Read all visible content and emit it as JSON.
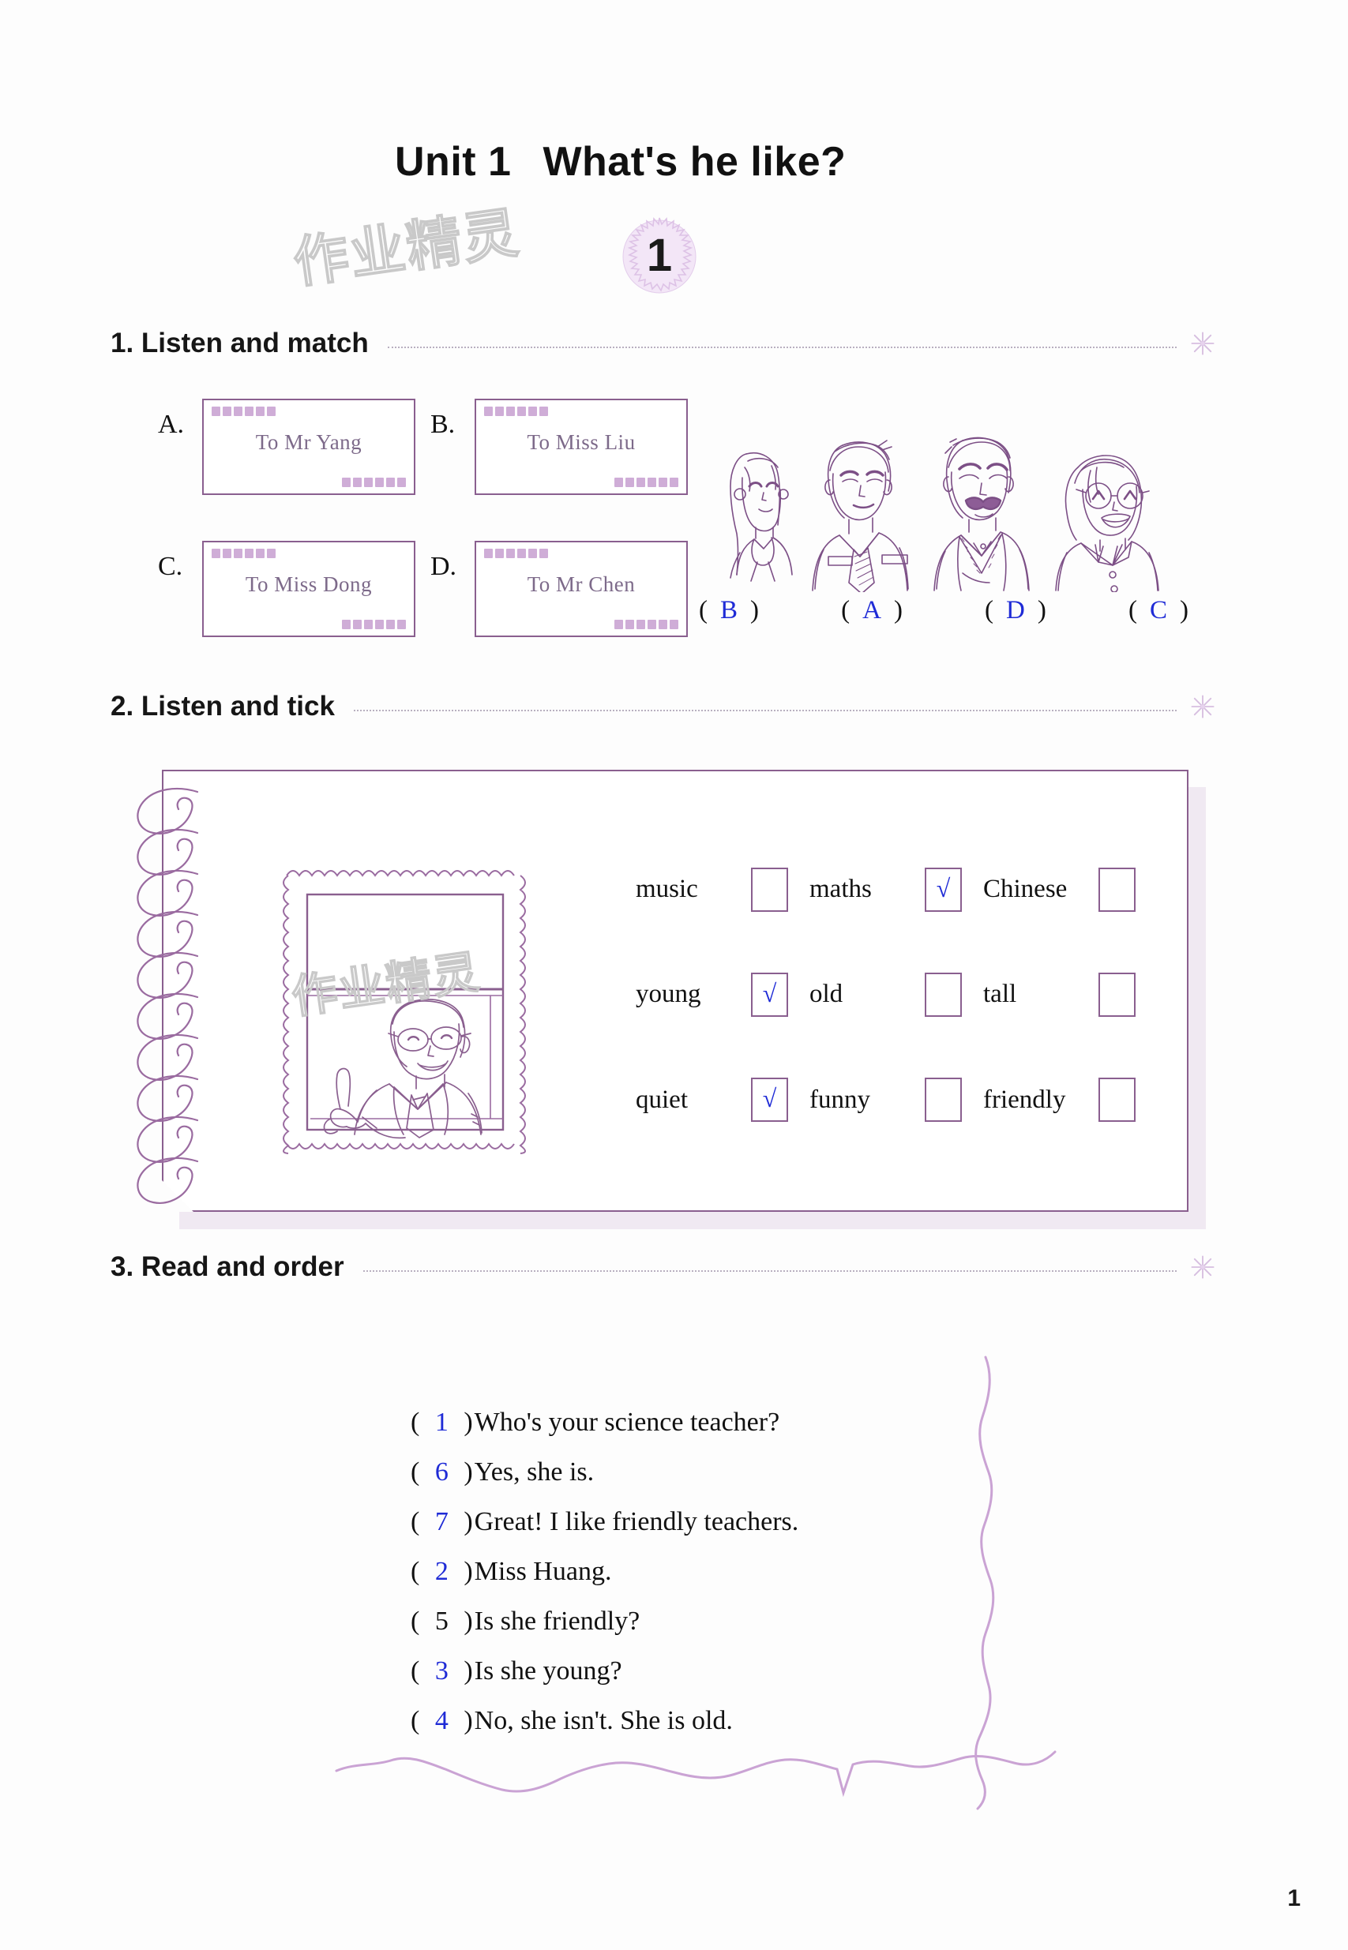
{
  "page": {
    "title_unit": "Unit 1",
    "title_question": "What's he like?",
    "unit_badge_number": "1",
    "watermark_text": "作业精灵",
    "page_number": "1",
    "accent_purple": "#8a5f8f",
    "accent_blue": "#1f2bd6",
    "stamp_purple": "#c79fd0"
  },
  "section1": {
    "number": "1.",
    "label": "1.  Listen and match",
    "envelopes": [
      {
        "letter": "A.",
        "text": "To Mr Yang"
      },
      {
        "letter": "B.",
        "text": "To Miss Liu"
      },
      {
        "letter": "C.",
        "text": "To Miss Dong"
      },
      {
        "letter": "D.",
        "text": "To Mr Chen"
      }
    ],
    "answers": [
      {
        "open": "(",
        "value": "B",
        "close": ")"
      },
      {
        "open": "(",
        "value": "A",
        "close": ")"
      },
      {
        "open": "(",
        "value": "D",
        "close": ")"
      },
      {
        "open": "(",
        "value": "C",
        "close": ")"
      }
    ],
    "people_icon": "four-teachers-illustration"
  },
  "section2": {
    "label": "2.  Listen and tick",
    "photo_icon": "framed-teacher-photo",
    "options": [
      {
        "label": "music",
        "checked": false,
        "mark": ""
      },
      {
        "label": "maths",
        "checked": true,
        "mark": "√"
      },
      {
        "label": "Chinese",
        "checked": false,
        "mark": ""
      },
      {
        "label": "young",
        "checked": true,
        "mark": "√"
      },
      {
        "label": "old",
        "checked": false,
        "mark": ""
      },
      {
        "label": "tall",
        "checked": false,
        "mark": ""
      },
      {
        "label": "quiet",
        "checked": true,
        "mark": "√"
      },
      {
        "label": "funny",
        "checked": false,
        "mark": ""
      },
      {
        "label": "friendly",
        "checked": false,
        "mark": ""
      }
    ]
  },
  "section3": {
    "label": "3.  Read and order",
    "lines": [
      {
        "open": "(",
        "num": "1",
        "close": ")",
        "sentence": "Who's your science teacher?",
        "num_color": "blue"
      },
      {
        "open": "(",
        "num": "6",
        "close": ")",
        "sentence": "Yes, she is.",
        "num_color": "blue"
      },
      {
        "open": "(",
        "num": "7",
        "close": ")",
        "sentence": "Great! I like friendly teachers.",
        "num_color": "blue"
      },
      {
        "open": "(",
        "num": "2",
        "close": ")",
        "sentence": "Miss Huang.",
        "num_color": "blue"
      },
      {
        "open": "(",
        "num": "5",
        "close": ")",
        "sentence": "Is she friendly?",
        "num_color": "black"
      },
      {
        "open": "(",
        "num": "3",
        "close": ")",
        "sentence": "Is she young?",
        "num_color": "blue"
      },
      {
        "open": "(",
        "num": "4",
        "close": ")",
        "sentence": "No, she isn't. She is old.",
        "num_color": "blue"
      }
    ]
  }
}
